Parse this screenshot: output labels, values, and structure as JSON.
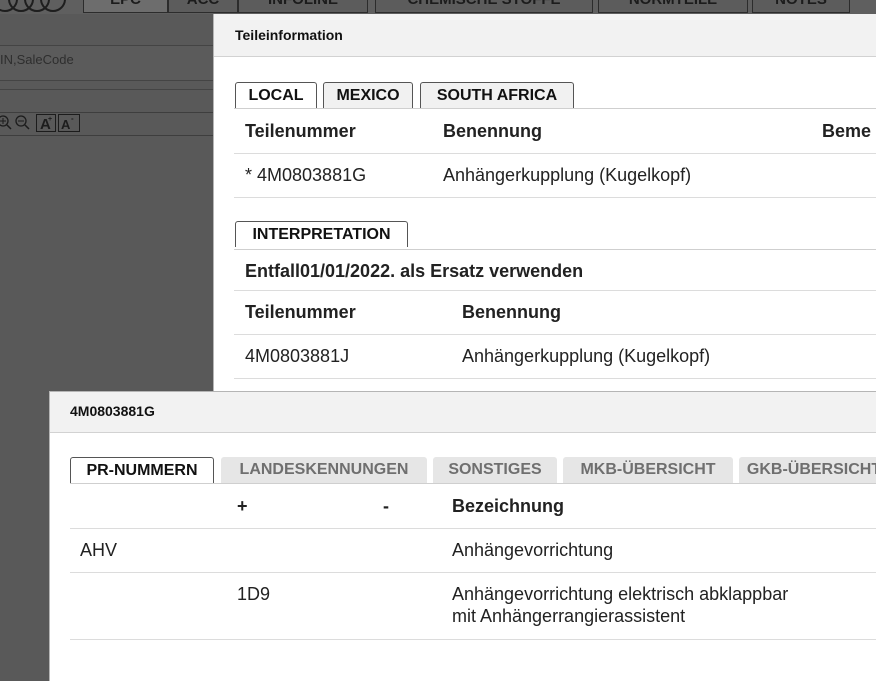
{
  "background_app": {
    "top_tabs": [
      "EPC",
      "ACC",
      "INFOLINE",
      "CHEMISCHE STOFFE",
      "NORMTEILE",
      "NOTES"
    ],
    "search_placeholder": "IN,SaleCode",
    "toolbar_icons": [
      "zoom-in-icon",
      "zoom-out-icon",
      "font-increase-icon",
      "font-decrease-icon"
    ]
  },
  "parts_info_dialog": {
    "title": "Teileinformation",
    "tabs": [
      "LOCAL",
      "MEXICO",
      "SOUTH AFRICA"
    ],
    "active_tab": "LOCAL",
    "table": {
      "headers": [
        "Teilenummer",
        "Benennung",
        "Beme"
      ],
      "rows": [
        {
          "part_number": "* 4M0803881G",
          "name": "Anhängerkupplung (Kugelkopf)"
        }
      ]
    },
    "interpretation": {
      "tab_label": "INTERPRETATION",
      "note": "Entfall01/01/2022. als Ersatz verwenden",
      "headers": [
        "Teilenummer",
        "Benennung"
      ],
      "rows": [
        {
          "part_number": "4M0803881J",
          "name": "Anhängerkupplung (Kugelkopf)"
        }
      ]
    }
  },
  "pr_dialog": {
    "title": "4M0803881G",
    "tabs": [
      "PR-NUMMERN",
      "LANDESKENNUNGEN",
      "SONSTIGES",
      "MKB-ÜBERSICHT",
      "GKB-ÜBERSICHT"
    ],
    "active_tab": "PR-NUMMERN",
    "table": {
      "headers": [
        "",
        "+",
        "-",
        "Bezeichnung"
      ],
      "rows": [
        {
          "family": "AHV",
          "plus": "",
          "minus": "",
          "description_1": "Anhängevorrichtung",
          "description_2": ""
        },
        {
          "family": "",
          "plus": "1D9",
          "minus": "",
          "description_1": "Anhängevorrichtung elektrisch abklappbar",
          "description_2": "mit Anhängerrangierassistent"
        }
      ]
    }
  }
}
